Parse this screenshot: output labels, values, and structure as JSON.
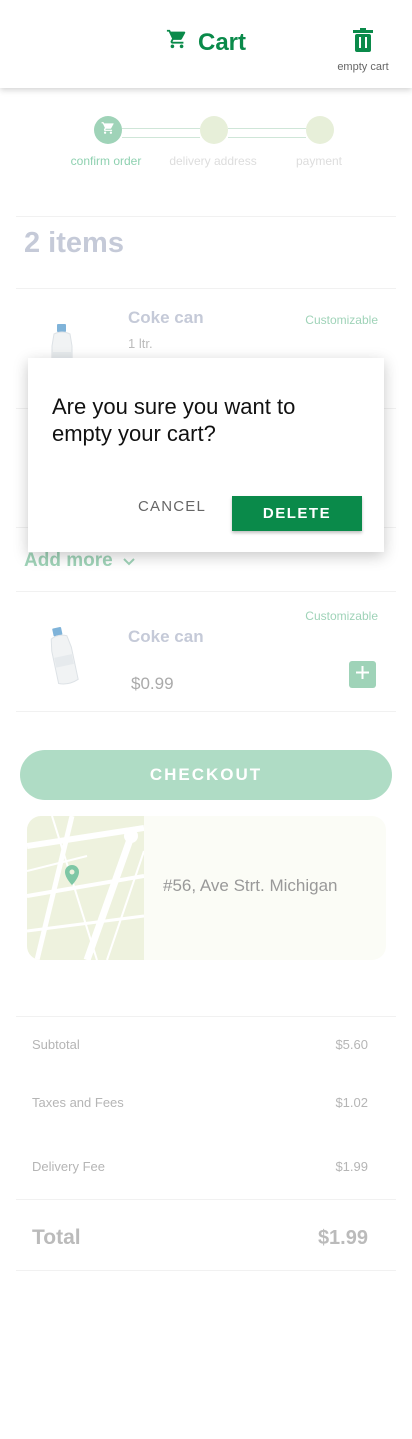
{
  "header": {
    "title": "Cart",
    "empty_cart_label": "empty cart",
    "cart_icon": "cart-icon",
    "trash_icon": "trash-icon"
  },
  "stepper": {
    "steps": [
      {
        "label": "confirm order",
        "active": true
      },
      {
        "label": "delivery address",
        "active": false
      },
      {
        "label": "payment",
        "active": false
      }
    ]
  },
  "cart": {
    "count_label": "2 items",
    "items": [
      {
        "name": "Coke can",
        "variant": "1 ltr.",
        "badge": "Customizable"
      }
    ]
  },
  "add_more": {
    "label": "Add more",
    "icon": "chevron-down-icon"
  },
  "suggested": {
    "name": "Coke can",
    "badge": "Customizable",
    "price": "$0.99",
    "add_icon": "plus-icon"
  },
  "checkout": {
    "label": "CHECKOUT"
  },
  "address": {
    "text": "#56, Ave Strt. Michigan"
  },
  "summary": {
    "rows": [
      {
        "label": "Subtotal",
        "value": "$5.60"
      },
      {
        "label": "Taxes and Fees",
        "value": "$1.02"
      },
      {
        "label": "Delivery Fee",
        "value": "$1.99"
      }
    ],
    "total_label": "Total",
    "total_value": "$1.99"
  },
  "dialog": {
    "message": "Are you sure you want to empty your cart?",
    "cancel_label": "CANCEL",
    "delete_label": "DELETE"
  },
  "colors": {
    "brand": "#0a8a4a",
    "accent_light": "#9fd3b8",
    "muted_text": "#c5cad8"
  }
}
